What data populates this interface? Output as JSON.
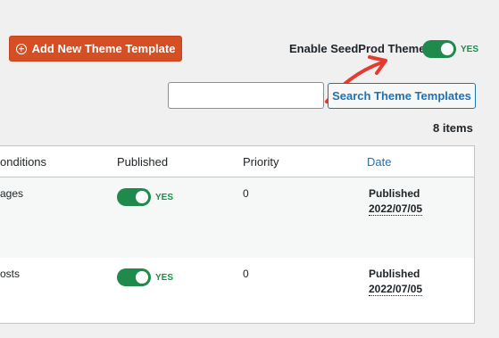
{
  "toolbar": {
    "add_button_label": "Add New Theme Template",
    "enable_label": "Enable SeedProd Theme",
    "enable_toggle_state": "YES"
  },
  "search": {
    "input_value": "",
    "button_label": "Search Theme Templates"
  },
  "items_count": "8 items",
  "table": {
    "columns": [
      "onditions",
      "Published",
      "Priority",
      "Date"
    ],
    "rows": [
      {
        "conditions": "ages",
        "published": "YES",
        "priority": "0",
        "date_status": "Published",
        "date_value": "2022/07/05"
      },
      {
        "conditions": "osts",
        "published": "YES",
        "priority": "0",
        "date_status": "Published",
        "date_value": "2022/07/05"
      }
    ]
  },
  "colors": {
    "accent": "#d64e24",
    "toggle_on": "#1f8a4c",
    "link": "#2271b1",
    "arrow": "#e53b2f"
  }
}
